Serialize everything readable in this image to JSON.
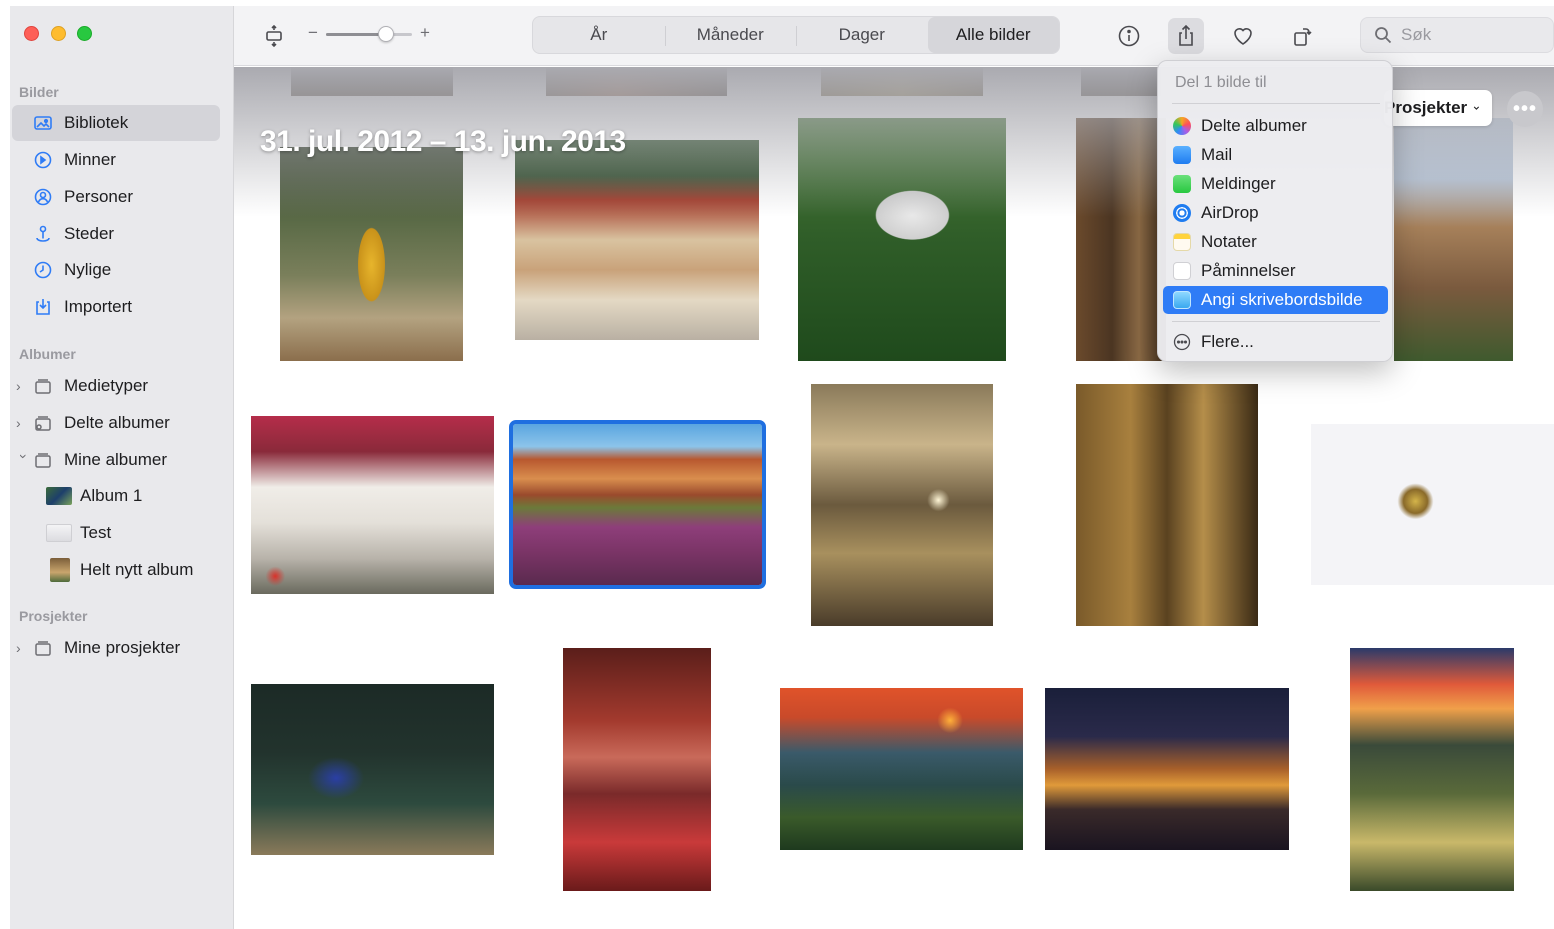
{
  "sidebar": {
    "sections": {
      "bilder": "Bilder",
      "albumer": "Albumer",
      "prosjekter": "Prosjekter"
    },
    "items": [
      {
        "label": "Bibliotek",
        "icon": "photo-library-icon"
      },
      {
        "label": "Minner",
        "icon": "memories-icon"
      },
      {
        "label": "Personer",
        "icon": "person-icon"
      },
      {
        "label": "Steder",
        "icon": "pin-icon"
      },
      {
        "label": "Nylige",
        "icon": "clock-icon"
      },
      {
        "label": "Importert",
        "icon": "import-icon"
      }
    ],
    "albums": [
      {
        "label": "Medietyper",
        "icon": "folder-icon"
      },
      {
        "label": "Delte albumer",
        "icon": "shared-folder-icon"
      },
      {
        "label": "Mine albumer",
        "icon": "folder-icon"
      },
      {
        "label": "Album 1"
      },
      {
        "label": "Test"
      },
      {
        "label": "Helt nytt album"
      }
    ],
    "projects": [
      {
        "label": "Mine prosjekter",
        "icon": "folder-icon"
      }
    ]
  },
  "toolbar": {
    "zoom_minus": "−",
    "zoom_plus": "+",
    "zoom_level": 0.7,
    "tabs": [
      "År",
      "Måneder",
      "Dager",
      "Alle bilder"
    ],
    "selected_tab": "Alle bilder",
    "search_placeholder": "Søk"
  },
  "content": {
    "date_range": "31. jul. 2012 – 13. jun. 2013",
    "projects_button": "Prosjekter",
    "more_button": "•••"
  },
  "share_menu": {
    "header": "Del 1 bilde til",
    "items": [
      {
        "label": "Delte albumer",
        "icon": "shared-albums-icon",
        "color": "#f5a623"
      },
      {
        "label": "Mail",
        "icon": "mail-icon",
        "color": "#2f8cf6"
      },
      {
        "label": "Meldinger",
        "icon": "messages-icon",
        "color": "#34c759"
      },
      {
        "label": "AirDrop",
        "icon": "airdrop-icon",
        "color": "#1f7cf0"
      },
      {
        "label": "Notater",
        "icon": "notes-icon",
        "color": "#ffd33d"
      },
      {
        "label": "Påminnelser",
        "icon": "reminders-icon",
        "color": "#ffffff"
      },
      {
        "label": "Angi skrivebordsbilde",
        "icon": "desktop-picture-icon",
        "color": "#5ac8fa"
      }
    ],
    "highlighted": "Angi skrivebordsbilde",
    "more": "Flere..."
  },
  "colors": {
    "accent": "#2f7cf6",
    "selection_outline": "#1f6fe0",
    "sidebar_bg": "#e9e9ec"
  }
}
